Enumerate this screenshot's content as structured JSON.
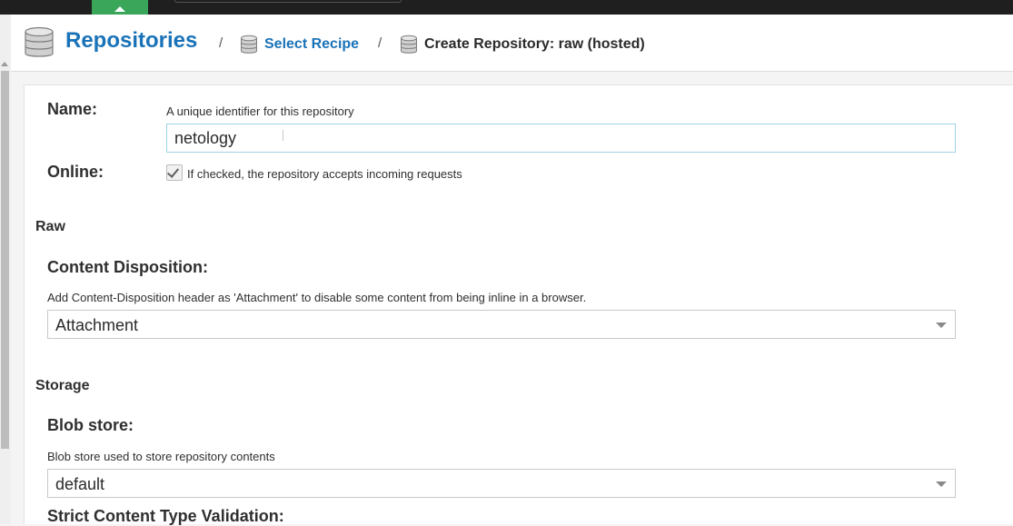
{
  "breadcrumb": {
    "root": "Repositories",
    "separator": "/",
    "step": "Select Recipe",
    "current": "Create Repository: raw (hosted)"
  },
  "form": {
    "name": {
      "label": "Name:",
      "help": "A unique identifier for this repository",
      "value": "netology"
    },
    "online": {
      "label": "Online:",
      "checked": true,
      "help": "If checked, the repository accepts incoming requests"
    },
    "raw_section": "Raw",
    "content_disposition": {
      "label": "Content Disposition:",
      "help": "Add Content-Disposition header as 'Attachment' to disable some content from being inline in a browser.",
      "value": "Attachment"
    },
    "storage_section": "Storage",
    "blob_store": {
      "label": "Blob store:",
      "help": "Blob store used to store repository contents",
      "value": "default"
    },
    "strict_validation": {
      "label": "Strict Content Type Validation:"
    }
  },
  "icons": {
    "breadcrumb_icon": "database-icon",
    "select_icon": "chevron-down-icon",
    "check_icon": "checkmark-icon"
  },
  "colors": {
    "link": "#1a73b8",
    "accent_tab": "#3aa65a",
    "input_focus_border": "#9fd3e6"
  }
}
